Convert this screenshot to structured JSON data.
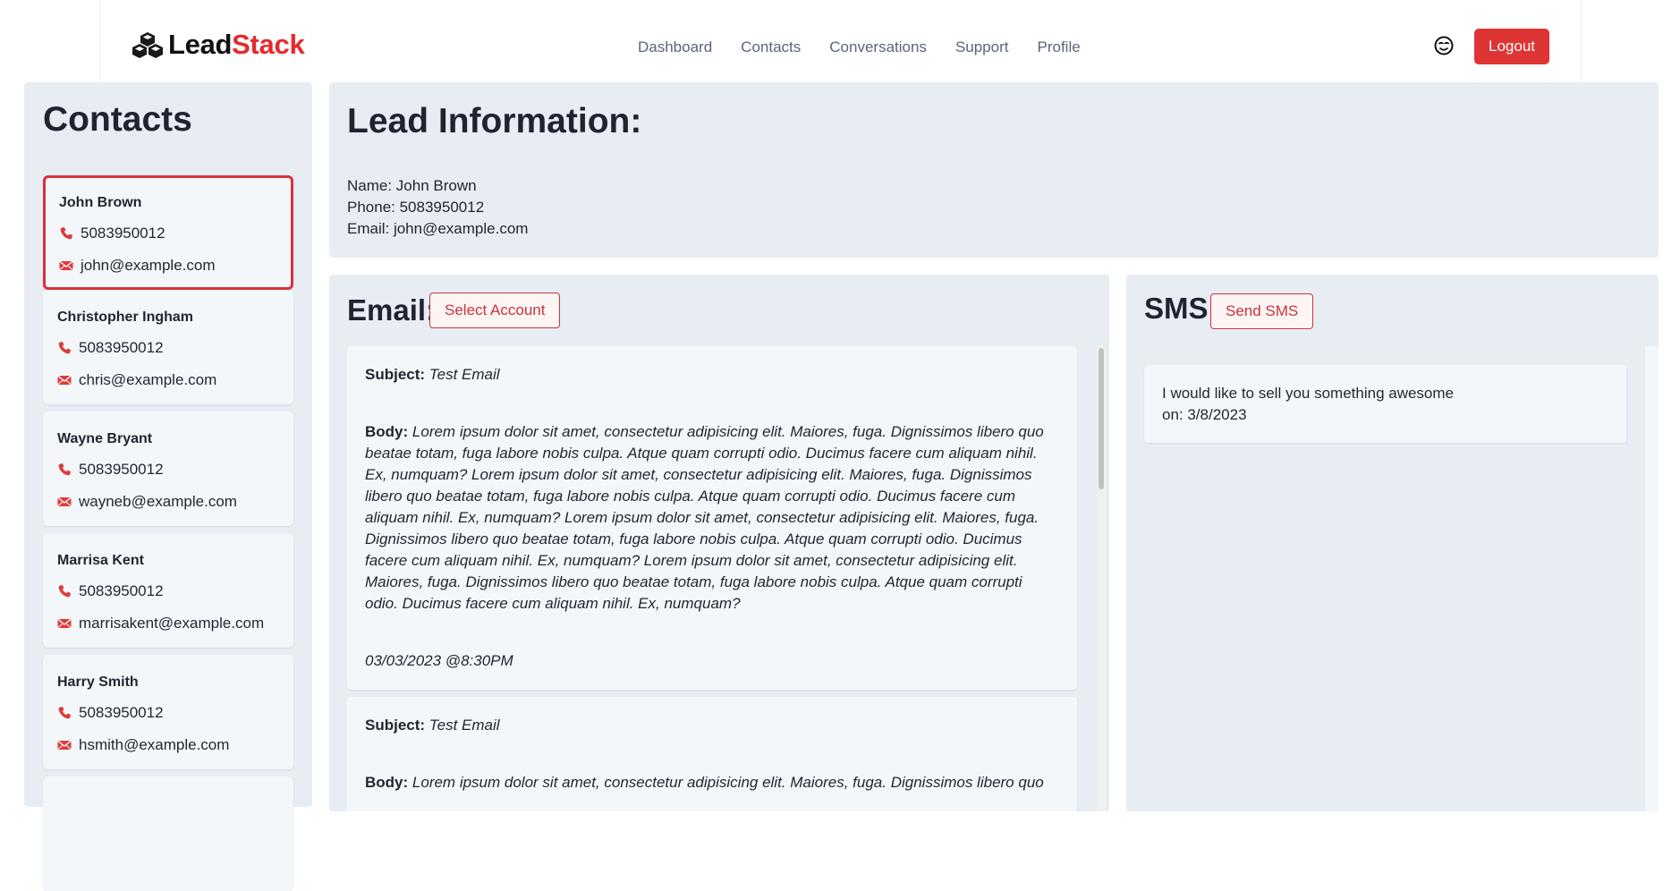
{
  "header": {
    "logo_lead": "Lead",
    "logo_stack": "Stack",
    "nav": [
      "Dashboard",
      "Contacts",
      "Conversations",
      "Support",
      "Profile"
    ],
    "logout_label": "Logout"
  },
  "sidebar": {
    "title": "Contacts",
    "contacts": [
      {
        "name": "John Brown",
        "phone": "5083950012",
        "email": "john@example.com"
      },
      {
        "name": "Christopher Ingham",
        "phone": "5083950012",
        "email": "chris@example.com"
      },
      {
        "name": "Wayne Bryant",
        "phone": "5083950012",
        "email": "wayneb@example.com"
      },
      {
        "name": "Marrisa Kent",
        "phone": "5083950012",
        "email": "marrisakent@example.com"
      },
      {
        "name": "Harry Smith",
        "phone": "5083950012",
        "email": "hsmith@example.com"
      }
    ]
  },
  "lead": {
    "title": "Lead Information:",
    "name_line": "Name: John Brown",
    "phone_line": "Phone: 5083950012",
    "email_line": "Email: john@example.com"
  },
  "email": {
    "title": "Email:",
    "select_account_label": "Select Account",
    "subject_label": "Subject:",
    "body_label": "Body:",
    "messages": [
      {
        "subject": "Test Email",
        "body": "Lorem ipsum dolor sit amet, consectetur adipisicing elit. Maiores, fuga. Dignissimos libero quo beatae totam, fuga labore nobis culpa. Atque quam corrupti odio. Ducimus facere cum aliquam nihil. Ex, numquam? Lorem ipsum dolor sit amet, consectetur adipisicing elit. Maiores, fuga. Dignissimos libero quo beatae totam, fuga labore nobis culpa. Atque quam corrupti odio. Ducimus facere cum aliquam nihil. Ex, numquam? Lorem ipsum dolor sit amet, consectetur adipisicing elit. Maiores, fuga. Dignissimos libero quo beatae totam, fuga labore nobis culpa. Atque quam corrupti odio. Ducimus facere cum aliquam nihil. Ex, numquam? Lorem ipsum dolor sit amet, consectetur adipisicing elit. Maiores, fuga. Dignissimos libero quo beatae totam, fuga labore nobis culpa. Atque quam corrupti odio. Ducimus facere cum aliquam nihil. Ex, numquam?",
        "date": "03/03/2023 @8:30PM"
      },
      {
        "subject": "Test Email",
        "body": "Lorem ipsum dolor sit amet, consectetur adipisicing elit. Maiores, fuga. Dignissimos libero quo",
        "date": ""
      }
    ]
  },
  "sms": {
    "title": "SMS:",
    "send_label": "Send SMS",
    "messages": [
      {
        "text": "I would like to sell you something awesome",
        "date_line": "on: 3/8/2023"
      }
    ]
  },
  "colors": {
    "accent": "#df3434",
    "panel_bg": "#e8edf4",
    "card_bg": "#f4f7fa"
  }
}
